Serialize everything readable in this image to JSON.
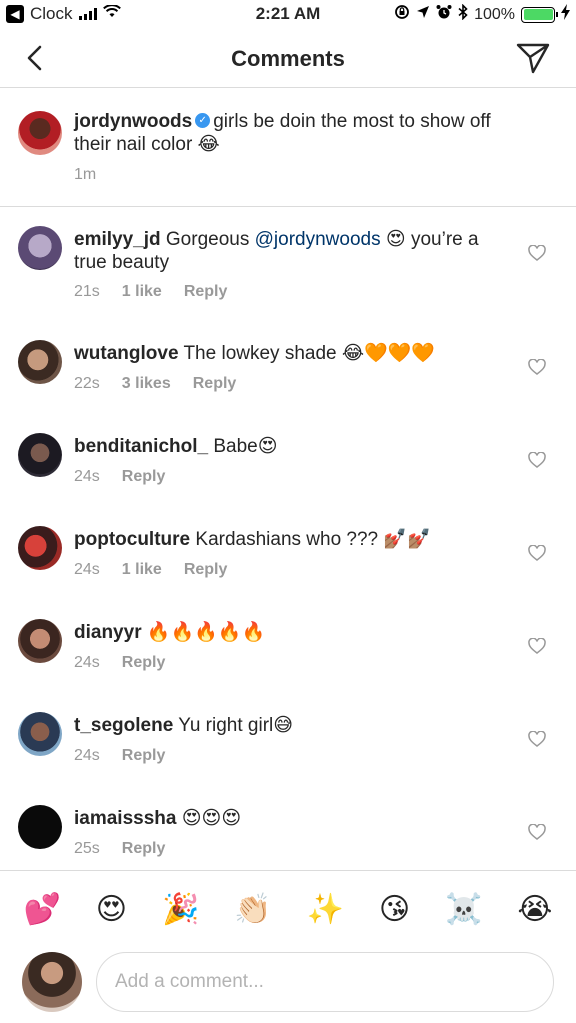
{
  "status_bar": {
    "back_app": "Clock",
    "time": "2:21 AM",
    "battery": "100%"
  },
  "nav": {
    "title": "Comments"
  },
  "caption": {
    "username": "jordynwoods",
    "text": "girls be doin the most to show off their nail color 😂",
    "time": "1m"
  },
  "comments": [
    {
      "username": "emilyy_jd",
      "text_before": "Gorgeous ",
      "mention": "@jordynwoods",
      "text_after": " 😍 you’re a true beauty",
      "time": "21s",
      "likes": "1 like",
      "reply": "Reply"
    },
    {
      "username": "wutanglove",
      "text": "The lowkey shade 😂🧡🧡🧡",
      "time": "22s",
      "likes": "3 likes",
      "reply": "Reply"
    },
    {
      "username": "benditanichol_",
      "text": "Babe😍",
      "time": "24s",
      "reply": "Reply"
    },
    {
      "username": "poptoculture",
      "text": "Kardashians who ??? 💅🏽💅🏽",
      "time": "24s",
      "likes": "1 like",
      "reply": "Reply"
    },
    {
      "username": "dianyyr",
      "text": "🔥🔥🔥🔥🔥",
      "time": "24s",
      "reply": "Reply"
    },
    {
      "username": "t_segolene",
      "text": "Yu right girl😅",
      "time": "24s",
      "reply": "Reply"
    },
    {
      "username": "iamaisssha",
      "text": "😍😍😍",
      "time": "25s",
      "reply": "Reply"
    }
  ],
  "emoji_bar": [
    "💕",
    "😍",
    "🎉",
    "👏🏻",
    "✨",
    "😘",
    "☠️",
    "😭"
  ],
  "input": {
    "placeholder": "Add a comment..."
  },
  "colors": {
    "username": "#262626",
    "meta": "#999999",
    "mention": "#003569",
    "verified": "#3897f0",
    "divider": "#dbdbdb"
  }
}
